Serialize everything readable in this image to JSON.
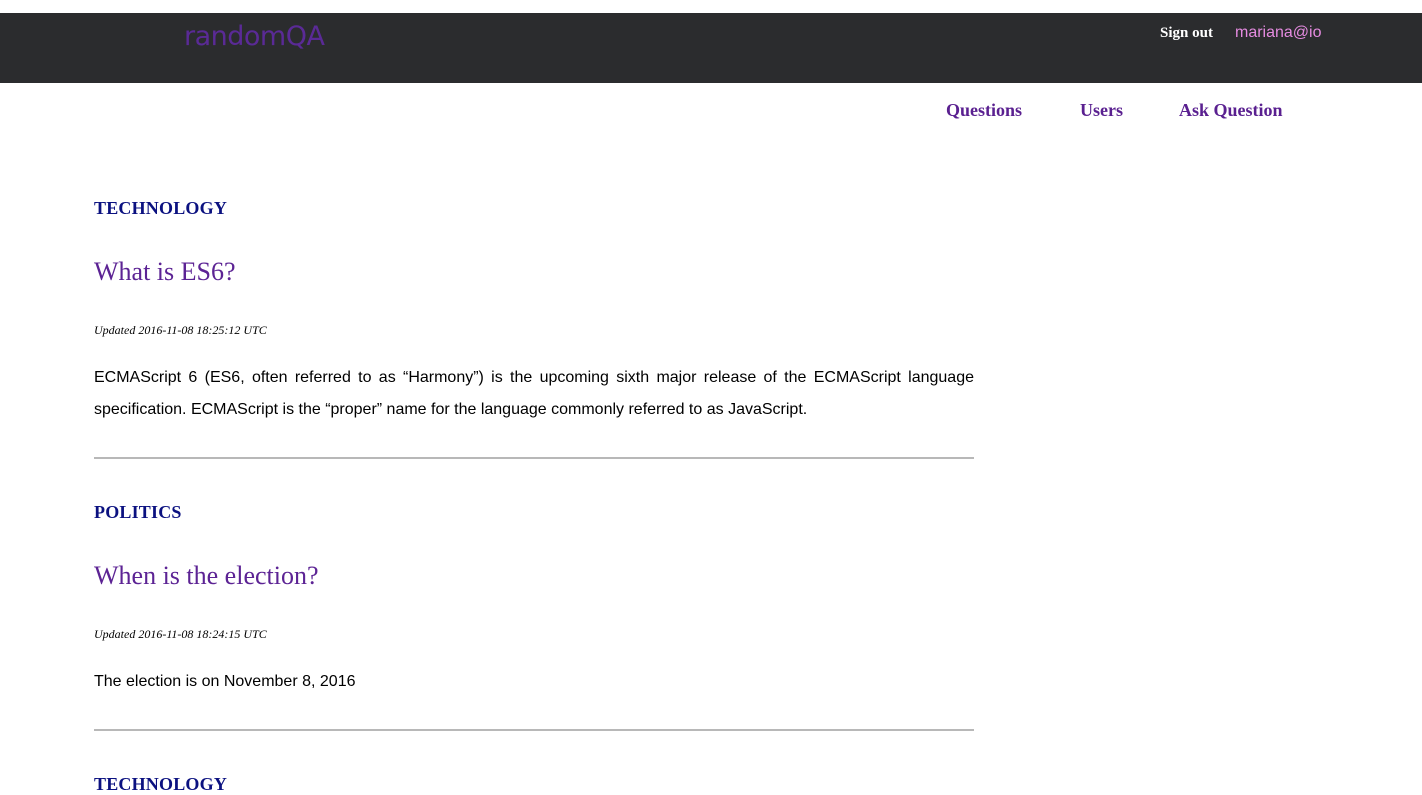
{
  "header": {
    "logo": "randomQA",
    "signout_label": "Sign out",
    "user_email": "mariana@io"
  },
  "nav": {
    "questions": "Questions",
    "users": "Users",
    "ask_question": "Ask Question"
  },
  "posts": [
    {
      "category": "TECHNOLOGY",
      "title": "What is ES6?",
      "updated": "Updated 2016-11-08 18:25:12 UTC",
      "body": "ECMAScript 6 (ES6, often referred to as “Harmony”) is the upcoming sixth major release of the ECMAScript language specification. ECMAScript is the “proper” name for the language commonly referred to as JavaScript."
    },
    {
      "category": "POLITICS",
      "title": "When is the election?",
      "updated": "Updated 2016-11-08 18:24:15 UTC",
      "body": "The election is on November 8, 2016"
    },
    {
      "category": "TECHNOLOGY"
    }
  ],
  "colors": {
    "header_bg": "#2b2c2e",
    "brand_purple": "#5c2394",
    "category_navy": "#0b1180",
    "email_pink": "#e58be0"
  }
}
